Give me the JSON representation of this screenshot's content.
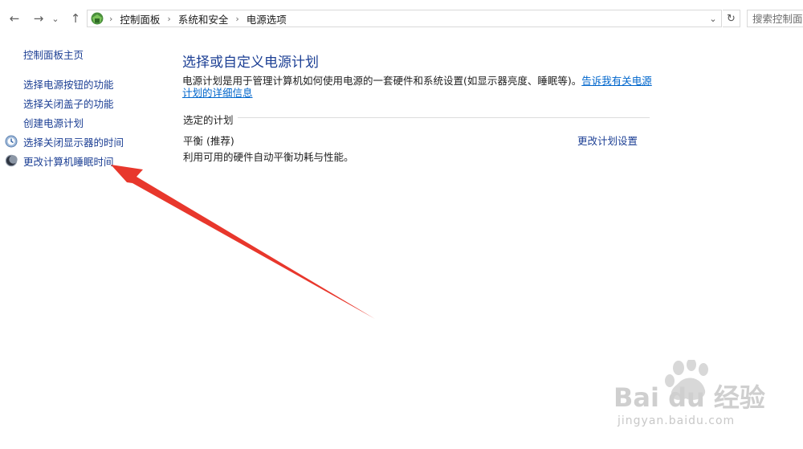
{
  "nav": {
    "back_glyph": "←",
    "forward_glyph": "→",
    "recent_glyph": "⌄",
    "up_glyph": "↑"
  },
  "address": {
    "icon": "control-panel-icon",
    "crumbs": [
      "控制面板",
      "系统和安全",
      "电源选项"
    ],
    "separator": "›",
    "dropdown_glyph": "⌄",
    "refresh_glyph": "↻"
  },
  "search": {
    "placeholder": "搜索控制面板"
  },
  "sidebar": {
    "home": "控制面板主页",
    "items": [
      {
        "label": "选择电源按钮的功能"
      },
      {
        "label": "选择关闭盖子的功能"
      },
      {
        "label": "创建电源计划"
      },
      {
        "label": "选择关闭显示器的时间",
        "icon": "display-power-icon"
      },
      {
        "label": "更改计算机睡眠时间",
        "icon": "sleep-moon-icon"
      }
    ]
  },
  "main": {
    "title": "选择或自定义电源计划",
    "description": "电源计划是用于管理计算机如何使用电源的一套硬件和系统设置(如显示器亮度、睡眠等)。",
    "description_link": "告诉我有关电源计划的详细信息",
    "selected_plan_label": "选定的计划",
    "plan": {
      "name": "平衡 (推荐)",
      "description": "利用可用的硬件自动平衡功耗与性能。",
      "settings_link": "更改计划设置"
    }
  },
  "watermark": {
    "logo_text": "Bai du 经验",
    "url": "jingyan.baidu.com"
  },
  "colors": {
    "link": "#1c3f94",
    "hyperlink": "#0066cc",
    "annotation_arrow": "#e8372c"
  }
}
